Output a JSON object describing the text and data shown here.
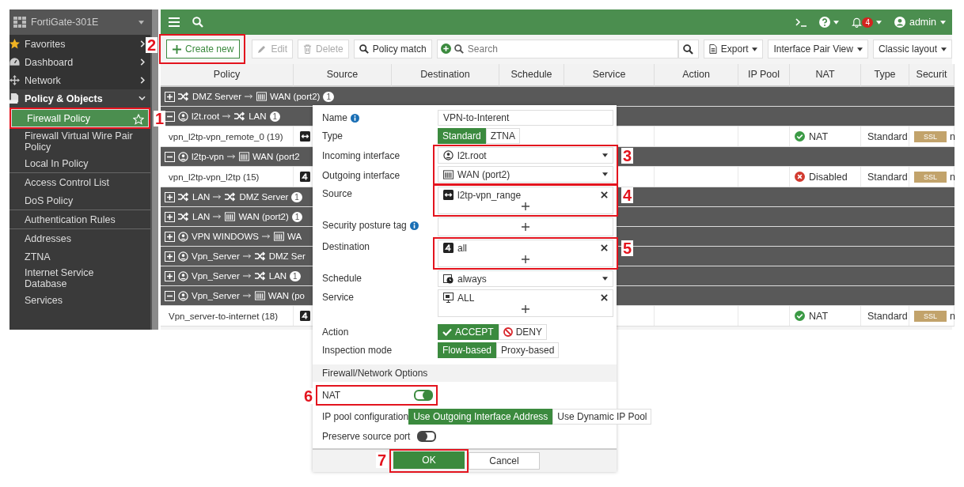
{
  "sidebar": {
    "title": "FortiGate-301E",
    "items": [
      {
        "label": "Favorites",
        "kind": "menu",
        "expanded": false,
        "selected": false
      },
      {
        "label": "Dashboard",
        "kind": "menu",
        "expanded": false,
        "selected": false
      },
      {
        "label": "Network",
        "kind": "menu",
        "expanded": false,
        "selected": false
      },
      {
        "label": "Policy & Objects",
        "kind": "menu",
        "expanded": true,
        "selected": false
      },
      {
        "label": "Firewall Policy",
        "kind": "sub",
        "selected": true,
        "marker": "1"
      },
      {
        "label": "Firewall Virtual Wire Pair Policy",
        "kind": "sub",
        "selected": false
      },
      {
        "label": "Local In Policy",
        "kind": "sub",
        "selected": false
      },
      {
        "label": "Access Control List",
        "kind": "sub",
        "selected": false,
        "divider_before": true
      },
      {
        "label": "DoS Policy",
        "kind": "sub",
        "selected": false
      },
      {
        "label": "Authentication Rules",
        "kind": "sub",
        "selected": false,
        "divider_before": true
      },
      {
        "label": "Addresses",
        "kind": "sub",
        "selected": false,
        "divider_before": true
      },
      {
        "label": "ZTNA",
        "kind": "sub",
        "selected": false
      },
      {
        "label": "Internet Service Database",
        "kind": "sub",
        "selected": false
      },
      {
        "label": "Services",
        "kind": "sub",
        "selected": false
      }
    ]
  },
  "topbar": {
    "notifications": "4",
    "user": "admin"
  },
  "toolbar": {
    "marker": "2",
    "buttons": [
      {
        "label": "Create new",
        "kind": "create",
        "disabled": false
      },
      {
        "label": "Edit",
        "kind": "edit",
        "disabled": true
      },
      {
        "label": "Delete",
        "kind": "delete",
        "disabled": true
      },
      {
        "label": "Policy match",
        "kind": "match",
        "disabled": false
      }
    ],
    "search": {
      "placeholder": "Search"
    },
    "menus": [
      {
        "label": "Export",
        "kind": "export"
      },
      {
        "label": "Interface Pair View",
        "kind": "plain"
      },
      {
        "label": "Classic layout",
        "kind": "plain"
      }
    ]
  },
  "table": {
    "columns": [
      "Policy",
      "Source",
      "Destination",
      "Schedule",
      "Service",
      "Action",
      "IP Pool",
      "NAT",
      "Type",
      "Securit"
    ],
    "groups": [
      {
        "expanded": false,
        "from": {
          "label": "DMZ Server",
          "kind": "zone"
        },
        "to": {
          "label": "WAN (port2)",
          "kind": "port",
          "count": "1"
        }
      },
      {
        "expanded": true,
        "from": {
          "label": "l2t.root",
          "kind": "tunnel"
        },
        "to": {
          "label": "LAN",
          "kind": "zone",
          "count": "1"
        },
        "policies": [
          {
            "name": "vpn_l2tp-vpn_remote_0 (19)",
            "source": {
              "kind": "range"
            },
            "nat": {
              "label": "NAT",
              "enabled": true
            },
            "type": "Standard",
            "security": {
              "badge": "SSL",
              "text": "n"
            }
          }
        ]
      },
      {
        "expanded": true,
        "from": {
          "label": "l2tp-vpn",
          "kind": "tunnel"
        },
        "to": {
          "label": "WAN (port2",
          "kind": "port"
        },
        "policies": [
          {
            "name": "vpn_l2tp-vpn_l2tp (15)",
            "source": {
              "kind": "all"
            },
            "nat": {
              "label": "Disabled",
              "enabled": false
            },
            "type": "Standard",
            "security": {
              "badge": "SSL",
              "text": "n"
            }
          }
        ]
      },
      {
        "expanded": false,
        "from": {
          "label": "LAN",
          "kind": "zone"
        },
        "to": {
          "label": "DMZ Server",
          "kind": "zone",
          "count": "1"
        }
      },
      {
        "expanded": false,
        "from": {
          "label": "LAN",
          "kind": "zone"
        },
        "to": {
          "label": "WAN (port2)",
          "kind": "port",
          "count": "1"
        }
      },
      {
        "expanded": false,
        "from": {
          "label": "VPN WINDOWS",
          "kind": "tunnel"
        },
        "to": {
          "label": "WA",
          "kind": "port"
        }
      },
      {
        "expanded": false,
        "from": {
          "label": "Vpn_Server",
          "kind": "tunnel"
        },
        "to": {
          "label": "DMZ Ser",
          "kind": "zone"
        }
      },
      {
        "expanded": false,
        "from": {
          "label": "Vpn_Server",
          "kind": "tunnel"
        },
        "to": {
          "label": "LAN",
          "kind": "zone",
          "count": "1"
        }
      },
      {
        "expanded": true,
        "from": {
          "label": "Vpn_Server",
          "kind": "tunnel"
        },
        "to": {
          "label": "WAN (po",
          "kind": "port"
        },
        "policies": [
          {
            "name": "Vpn_server-to-internet (18)",
            "source": {
              "kind": "all"
            },
            "nat": {
              "label": "NAT",
              "enabled": true
            },
            "type": "Standard",
            "security": {
              "badge": "SSL",
              "text": "n"
            }
          }
        ]
      }
    ]
  },
  "dialog": {
    "name": {
      "label": "Name",
      "value": "VPN-to-Interent"
    },
    "type": {
      "label": "Type",
      "options": [
        {
          "label": "Standard",
          "selected": true
        },
        {
          "label": "ZTNA",
          "selected": false
        }
      ]
    },
    "interfaces": {
      "marker": "3",
      "incoming": {
        "label": "Incoming interface",
        "value": "l2t.root"
      },
      "outgoing": {
        "label": "Outgoing interface",
        "value": "WAN (port2)"
      }
    },
    "source": {
      "label": "Source",
      "marker": "4",
      "items": [
        "l2tp-vpn_range"
      ]
    },
    "posture": {
      "label": "Security posture tag"
    },
    "destination": {
      "label": "Destination",
      "marker": "5",
      "items": [
        "all"
      ]
    },
    "schedule": {
      "label": "Schedule",
      "value": "always"
    },
    "service": {
      "label": "Service",
      "items": [
        "ALL"
      ]
    },
    "action": {
      "label": "Action",
      "options": [
        {
          "label": "ACCEPT",
          "kind": "accept",
          "selected": true
        },
        {
          "label": "DENY",
          "kind": "deny",
          "selected": false
        }
      ]
    },
    "inspection": {
      "label": "Inspection mode",
      "options": [
        {
          "label": "Flow-based",
          "selected": true
        },
        {
          "label": "Proxy-based",
          "selected": false
        }
      ]
    },
    "section": "Firewall/Network Options",
    "nat": {
      "label": "NAT",
      "on": true,
      "marker": "6"
    },
    "ip_pool": {
      "label": "IP pool configuration",
      "options": [
        {
          "label": "Use Outgoing Interface Address",
          "selected": true
        },
        {
          "label": "Use Dynamic IP Pool",
          "selected": false
        }
      ]
    },
    "preserve": {
      "label": "Preserve source port",
      "on": false
    },
    "buttons": [
      {
        "label": "OK",
        "kind": "primary",
        "marker": "7"
      },
      {
        "label": "Cancel",
        "kind": "secondary"
      }
    ]
  }
}
